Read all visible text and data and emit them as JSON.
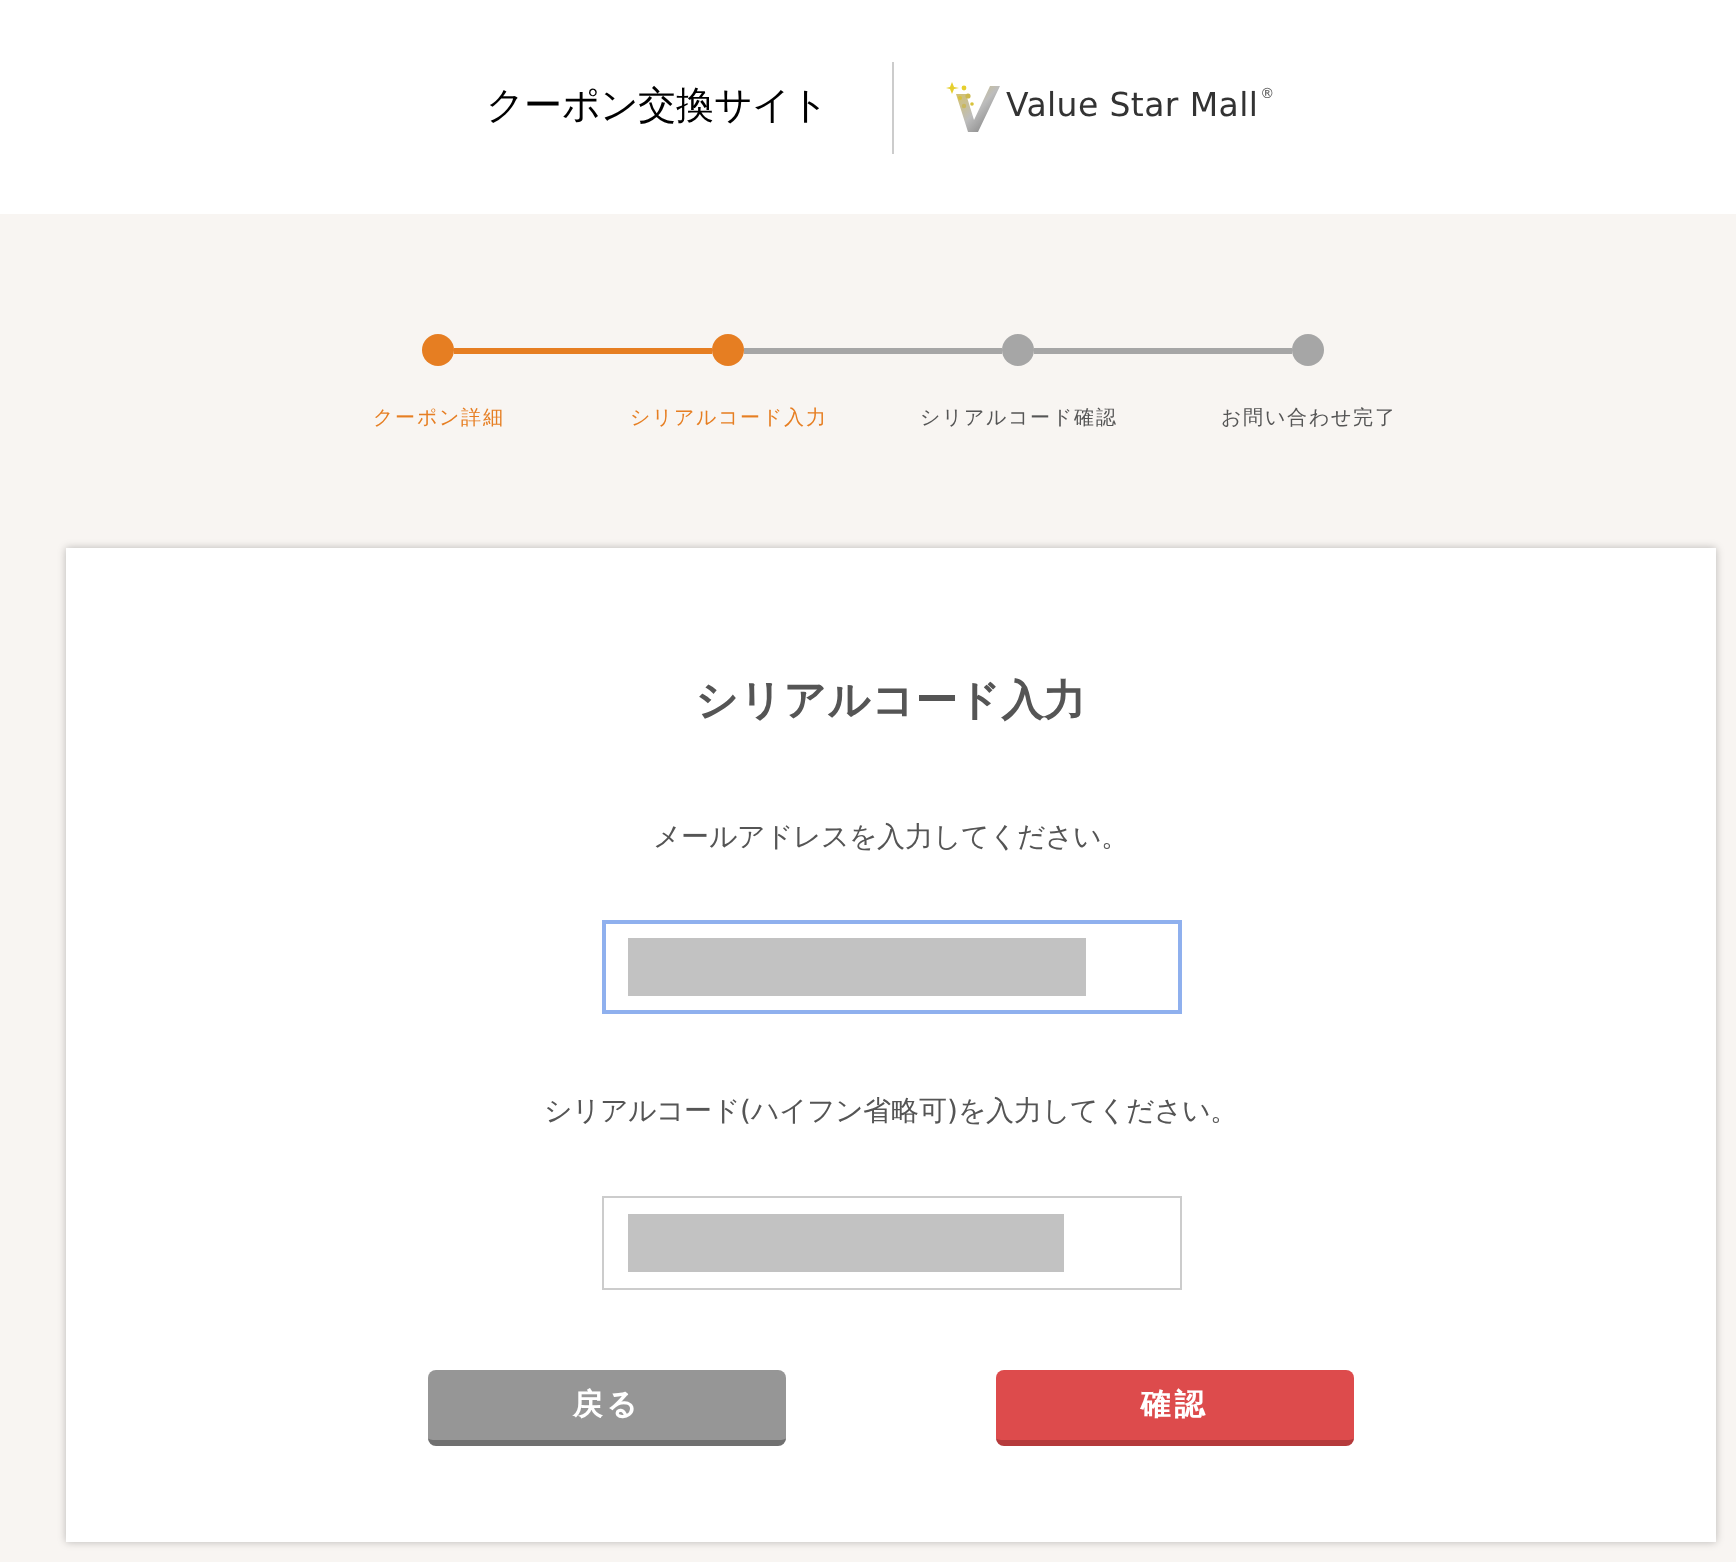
{
  "header": {
    "site_title": "クーポン交換サイト",
    "logo": {
      "name": "Value Star Mall",
      "mark": "®"
    }
  },
  "steps": [
    {
      "label": "クーポン詳細",
      "reached": true
    },
    {
      "label": "シリアルコード入力",
      "reached": true
    },
    {
      "label": "シリアルコード確認",
      "reached": false
    },
    {
      "label": "お問い合わせ完了",
      "reached": false
    }
  ],
  "form": {
    "title": "シリアルコード入力",
    "fields": [
      {
        "label": "メールアドレスを入力してください。",
        "focused": true,
        "masked": true
      },
      {
        "label": "シリアルコード(ハイフン省略可)を入力してください。",
        "focused": false,
        "masked": true
      }
    ],
    "buttons": [
      {
        "label": "戻る",
        "kind": "secondary"
      },
      {
        "label": "確認",
        "kind": "primary"
      }
    ]
  }
}
